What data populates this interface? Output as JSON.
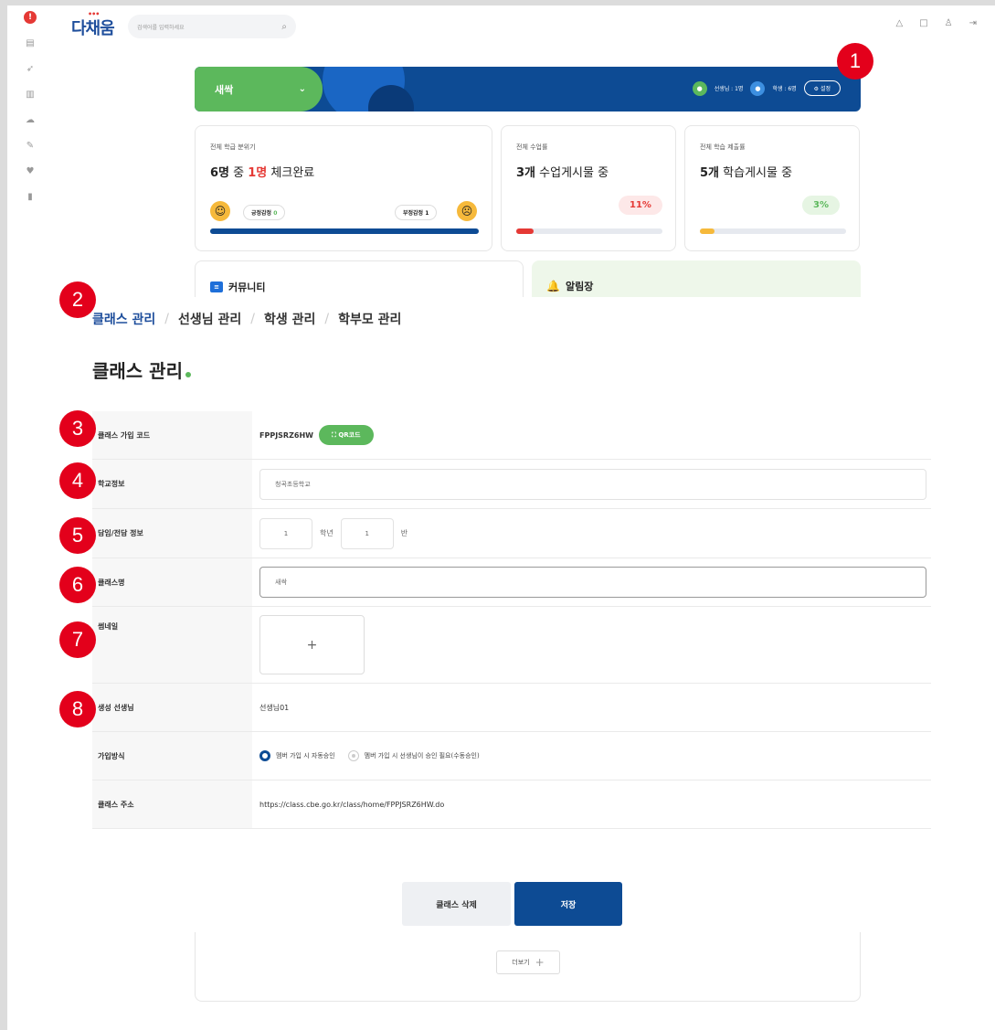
{
  "header": {
    "logo": "다채움",
    "search_placeholder": "검색어를 입력하세요",
    "search_icon": "search-icon",
    "top_icons": [
      "bell-icon",
      "bookmark-icon",
      "user-icon",
      "logout-icon"
    ]
  },
  "sidebar": {
    "items": [
      "home-icon",
      "board-icon",
      "rocket-icon",
      "chart-icon",
      "cloud-icon",
      "edit-icon",
      "heart-icon",
      "book-icon"
    ]
  },
  "banner": {
    "class_name": "새싹",
    "teacher_count": "선생님 : 1명",
    "student_count": "학생 : 6명",
    "settings_label": "설정"
  },
  "cards": {
    "mood": {
      "label": "전체 학급 분위기",
      "total": "6명",
      "middle": " 중 ",
      "checked": "1명",
      "suffix": " 체크완료",
      "positive_label": "긍정감정",
      "positive_count": "0",
      "negative_label": "부정감정",
      "negative_count": "1",
      "fill": 1.0
    },
    "lessons": {
      "label": "전체 수업률",
      "count": "3개",
      "suffix": " 수업게시물 중",
      "pct": "11%",
      "fill": 0.11
    },
    "assignments": {
      "label": "전체 학습 제출률",
      "count": "5개",
      "suffix": " 학습게시물 중",
      "pct": "3%",
      "fill": 0.03
    }
  },
  "community": {
    "title": "커뮤니티"
  },
  "notice": {
    "title": "알림장"
  },
  "breadcrumb": [
    "클래스 관리",
    "선생님 관리",
    "학생 관리",
    "학부모 관리"
  ],
  "page_title": "클래스 관리",
  "form": {
    "join_code_label": "클래스 가입 코드",
    "join_code": "FPPJSRZ6HW",
    "qr_button": "QR코드",
    "school_label": "학교정보",
    "school": "청곡초등학교",
    "grade_label": "담임/전담 정보",
    "grade": "1",
    "grade_unit": "학년",
    "class_num": "1",
    "class_unit": "반",
    "class_name_label": "클래스명",
    "class_name": "새싹",
    "thumbnail_label": "썸네일",
    "thumbnail_add": "+",
    "creator_label": "생성 선생님",
    "creator": "선생님01",
    "join_method_label": "가입방식",
    "join_auto": "멤버 가입 시 자동승인",
    "join_manual": "멤버 가입 시 선생님이 승인 필요(수동승인)",
    "address_label": "클래스 주소",
    "address": "https://class.cbe.go.kr/class/home/FPPJSRZ6HW.do"
  },
  "actions": {
    "delete": "클래스 삭제",
    "save": "저장"
  },
  "more": {
    "label": "더보기",
    "plus": "+"
  },
  "markers": [
    "1",
    "2",
    "3",
    "4",
    "5",
    "6",
    "7",
    "8"
  ],
  "colors": {
    "primary": "#0d4b94",
    "accent_green": "#5cb85c",
    "marker_red": "#e3001b"
  }
}
